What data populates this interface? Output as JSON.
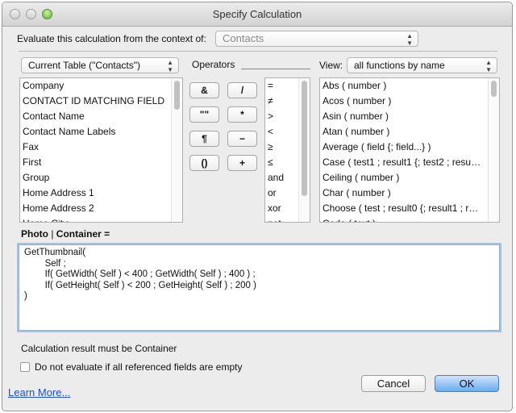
{
  "window": {
    "title": "Specify Calculation"
  },
  "context": {
    "label": "Evaluate this calculation from the context of:",
    "value": "Contacts"
  },
  "table_select": {
    "value": "Current Table (\"Contacts\")"
  },
  "operators_label": "Operators",
  "view": {
    "label": "View:",
    "value": "all functions by name"
  },
  "fields": [
    "Company",
    "CONTACT ID MATCHING FIELD",
    "Contact Name",
    "Contact Name Labels",
    "Fax",
    "First",
    "Group",
    "Home Address 1",
    "Home Address 2",
    "Home City"
  ],
  "operator_buttons": [
    "&",
    "/",
    "\"\"",
    "*",
    "¶",
    "−",
    "()",
    "+"
  ],
  "operator_list": [
    "=",
    "≠",
    ">",
    "<",
    "≥",
    "≤",
    "and",
    "or",
    "xor",
    "not"
  ],
  "functions": [
    "Abs ( number )",
    "Acos ( number )",
    "Asin ( number )",
    "Atan ( number )",
    "Average ( field {; field...} )",
    "Case ( test1 ; result1 {; test2 ; resu…",
    "Ceiling ( number )",
    "Char ( number )",
    "Choose ( test ; result0 {; result1 ; r…",
    "Code ( text )"
  ],
  "field_heading": {
    "name": "Photo",
    "separator": " | ",
    "type": "Container",
    "suffix": " ="
  },
  "formula": "GetThumbnail(\n\tSelf ;\n\tIf( GetWidth( Self ) < 400 ; GetWidth( Self ) ; 400 ) ;\n\tIf( GetHeight( Self ) < 200 ; GetHeight( Self ) ; 200 )\n)",
  "result_type_text": "Calculation result must be Container",
  "do_not_evaluate": {
    "label": "Do not evaluate if all referenced fields are empty",
    "checked": false
  },
  "learn_more": "Learn More...",
  "cancel": "Cancel",
  "ok": "OK"
}
